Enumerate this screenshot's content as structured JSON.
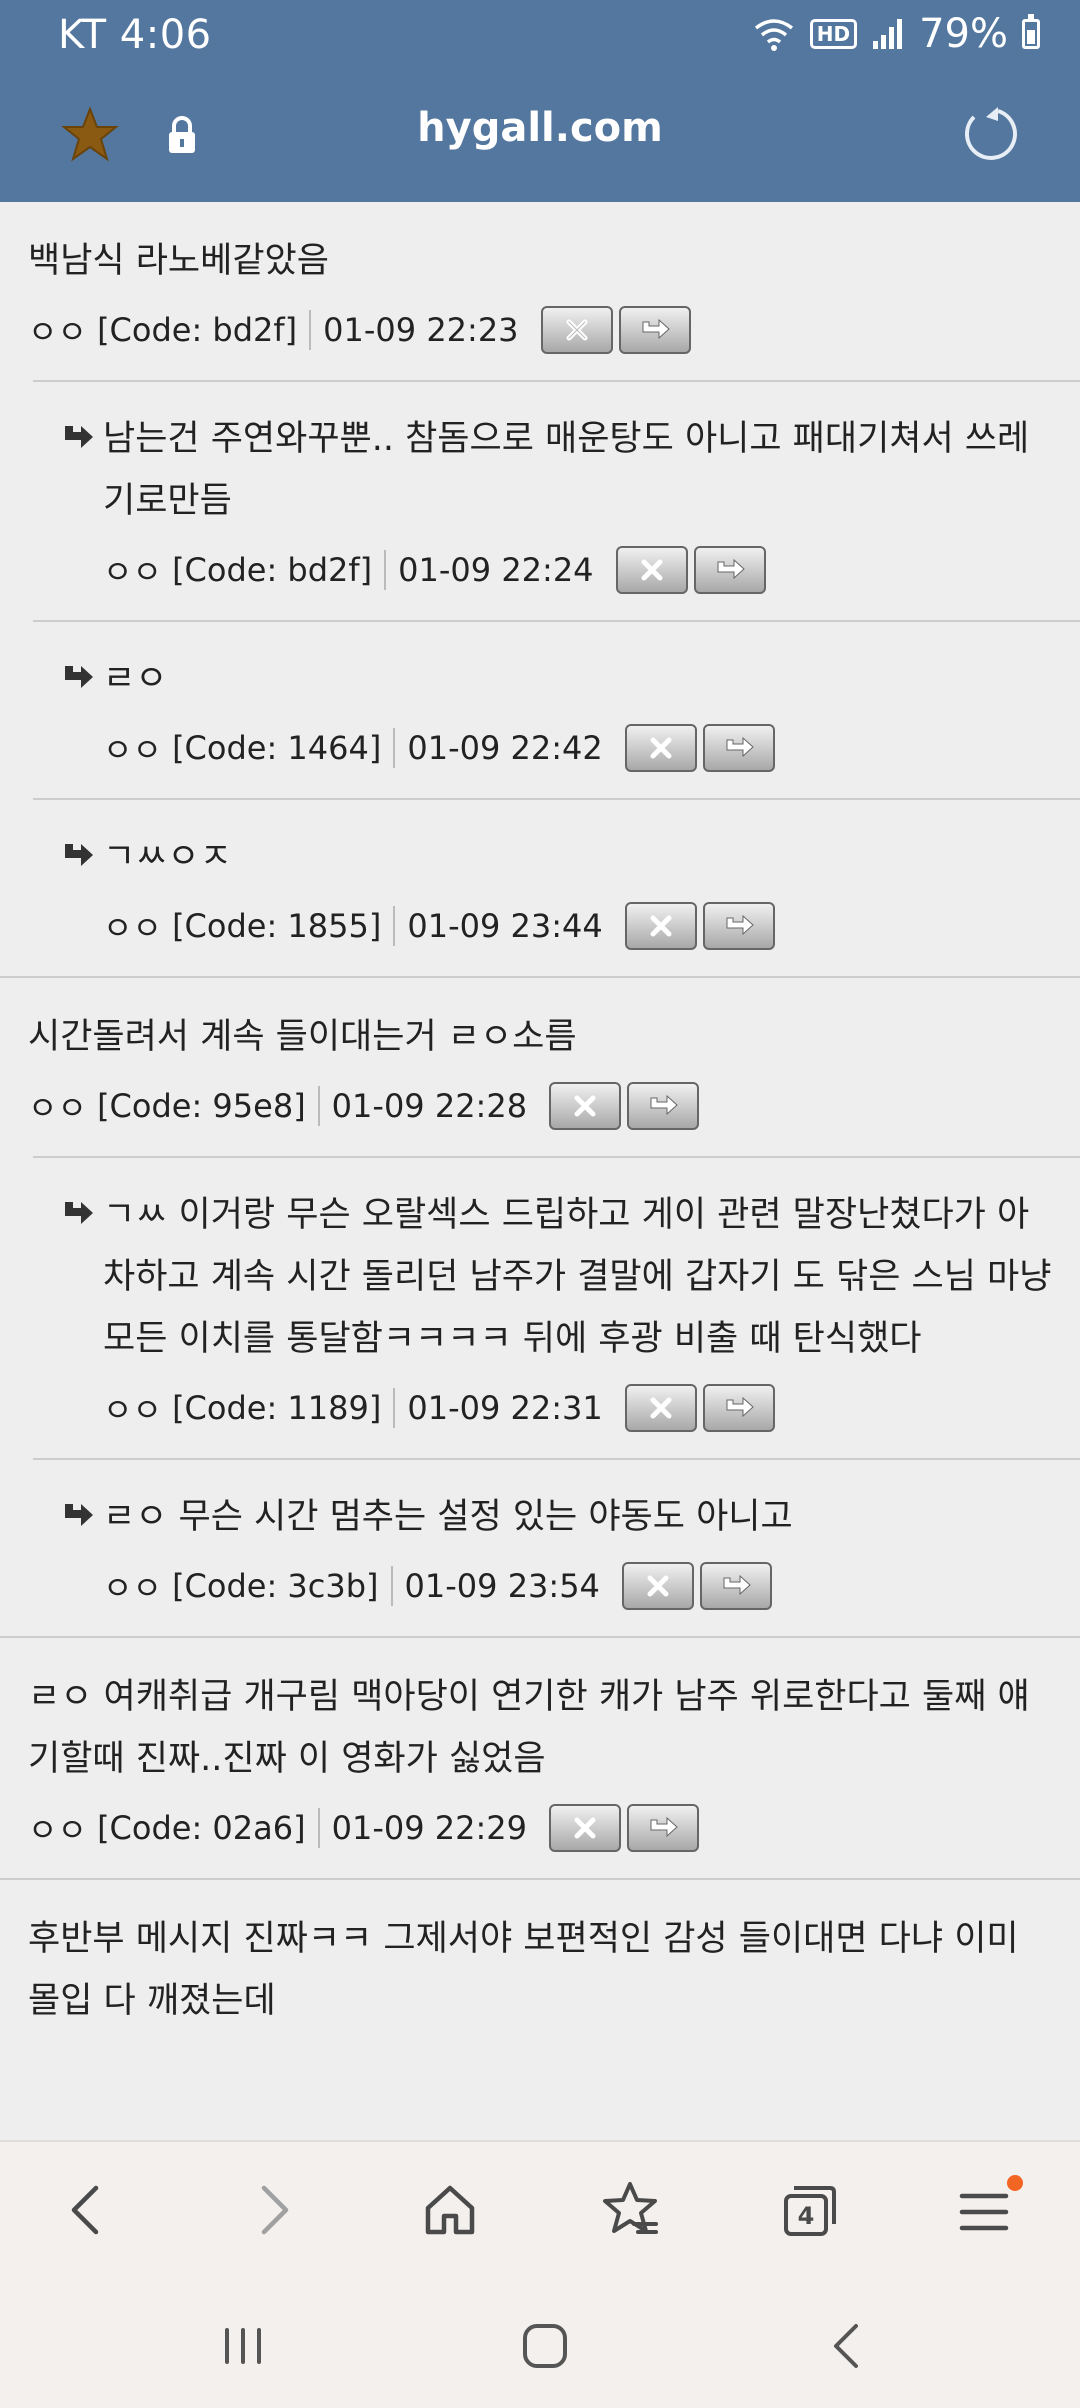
{
  "status_bar": {
    "carrier_time": "KT 4:06",
    "hd_label": "HD",
    "battery": "79%"
  },
  "browser": {
    "url": "hygall.com",
    "nav": {
      "tab_count": "4"
    }
  },
  "comments": [
    {
      "text": "백남식 라노베같았음",
      "author": "ㅇㅇ",
      "code": "[Code: bd2f]",
      "time": "01-09 22:23",
      "replies": [
        {
          "text": "남는건 주연와꾸뿐.. 참돔으로 매운탕도 아니고 패대기쳐서 쓰레기로만듬",
          "author": "ㅇㅇ",
          "code": "[Code: bd2f]",
          "time": "01-09 22:24"
        },
        {
          "text": "ㄹㅇ",
          "author": "ㅇㅇ",
          "code": "[Code: 1464]",
          "time": "01-09 22:42"
        },
        {
          "text": "ㄱㅆㅇㅈ",
          "author": "ㅇㅇ",
          "code": "[Code: 1855]",
          "time": "01-09 23:44"
        }
      ]
    },
    {
      "text": "시간돌려서 계속 들이대는거 ㄹㅇ소름",
      "author": "ㅇㅇ",
      "code": "[Code: 95e8]",
      "time": "01-09 22:28",
      "replies": [
        {
          "text": "ㄱㅆ 이거랑 무슨 오랄섹스 드립하고 게이 관련 말장난쳤다가 아차하고 계속 시간 돌리던 남주가 결말에 갑자기 도 닦은 스님 마냥 모든 이치를 통달함ㅋㅋㅋㅋ 뒤에 후광 비출 때 탄식했다",
          "author": "ㅇㅇ",
          "code": "[Code: 1189]",
          "time": "01-09 22:31"
        },
        {
          "text": "ㄹㅇ 무슨 시간 멈추는 설정 있는 야동도 아니고",
          "author": "ㅇㅇ",
          "code": "[Code: 3c3b]",
          "time": "01-09 23:54"
        }
      ]
    },
    {
      "text": "ㄹㅇ 여캐취급 개구림 맥아당이 연기한 캐가 남주 위로한다고 둘째 얘기할때 진짜..진짜 이 영화가 싫었음",
      "author": "ㅇㅇ",
      "code": "[Code: 02a6]",
      "time": "01-09 22:29",
      "replies": []
    },
    {
      "text": "후반부 메시지 진짜ㅋㅋ 그제서야 보편적인 감성 들이대면 다냐 이미 몰입 다 깨졌는데"
    }
  ],
  "colors": {
    "header_bg": "#53779e",
    "page_bg": "#eeeeee",
    "star": "#8a5a12",
    "notification_dot": "#f26522"
  },
  "icons": [
    "star-icon",
    "lock-icon",
    "reload-icon",
    "delete-icon",
    "reply-icon",
    "back-icon",
    "forward-icon",
    "home-icon",
    "bookmarks-icon",
    "tabs-icon",
    "menu-icon"
  ]
}
